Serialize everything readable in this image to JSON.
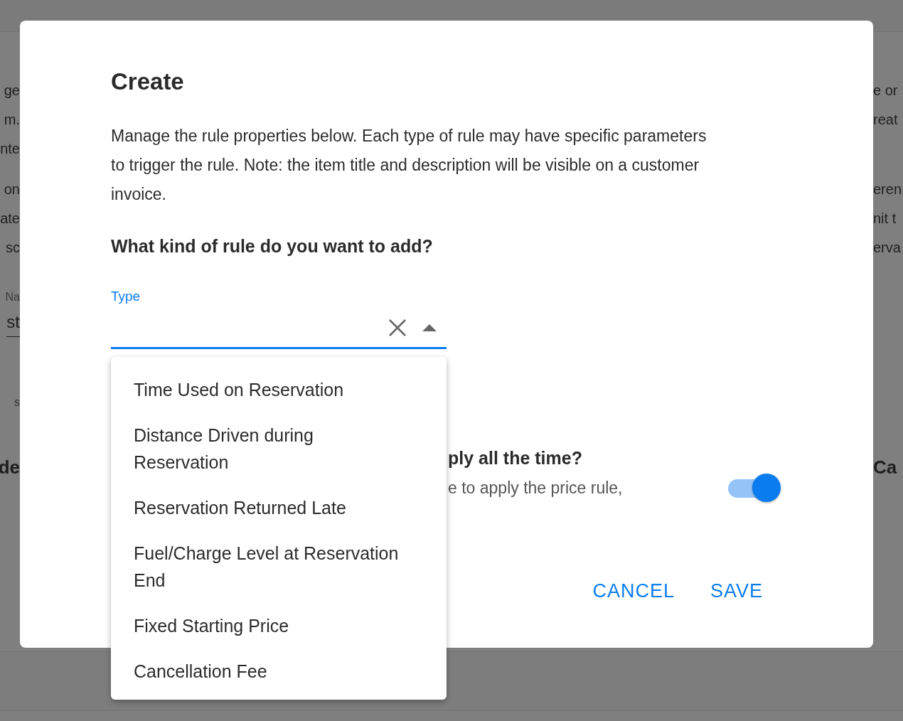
{
  "background": {
    "left": {
      "paragraphs": [
        [
          "ge",
          "m.",
          "nte"
        ],
        [
          "on",
          "ate",
          "sc"
        ]
      ],
      "field": {
        "label": "Na",
        "value": "st"
      },
      "note": "s",
      "heading": "de"
    },
    "right": {
      "paragraphs": [
        [
          "e or",
          "reat"
        ],
        [
          "eren",
          "nit t",
          "erva"
        ]
      ],
      "heading": "Ca"
    }
  },
  "dialog": {
    "title": "Create",
    "description": "Manage the rule properties below. Each type of rule may have specific parameters to trigger the rule. Note: the item title and description will be visible on a customer invoice.",
    "question": "What kind of rule do you want to add?",
    "type_field": {
      "label": "Type",
      "focused": true,
      "expanded": true,
      "options": [
        {
          "label": "Time Used on Reservation",
          "selected": false
        },
        {
          "label": "Distance Driven during Reservation",
          "selected": false
        },
        {
          "label": "Reservation Returned Late",
          "selected": false
        },
        {
          "label": "Fuel/Charge Level at Reservation End",
          "selected": false
        },
        {
          "label": "Fixed Starting Price",
          "selected": false
        },
        {
          "label": "Cancellation Fee",
          "selected": false
        }
      ]
    },
    "toggle_section": {
      "question": "ply all the time?",
      "hint": "e to apply the price rule,",
      "on": true
    },
    "buttons": [
      "CANCEL",
      "SAVE"
    ]
  }
}
